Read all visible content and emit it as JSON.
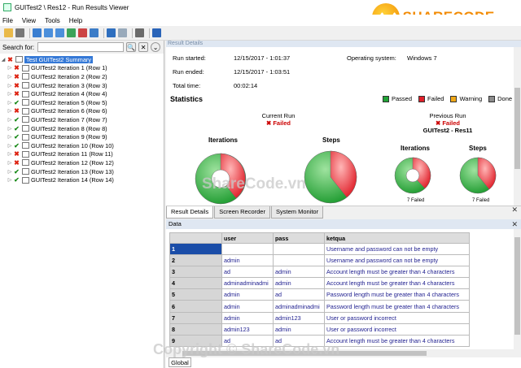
{
  "window": {
    "title": "GUITest2 \\ Res12 - Run Results Viewer"
  },
  "menu": [
    "File",
    "View",
    "Tools",
    "Help"
  ],
  "search": {
    "label": "Search for:"
  },
  "tree": {
    "root": "Test GUITest2 Summary",
    "items": [
      {
        "label": "GUITest2 Iteration 1 (Row 1)",
        "status": "fail"
      },
      {
        "label": "GUITest2 Iteration 2 (Row 2)",
        "status": "fail"
      },
      {
        "label": "GUITest2 Iteration 3 (Row 3)",
        "status": "fail"
      },
      {
        "label": "GUITest2 Iteration 4 (Row 4)",
        "status": "fail"
      },
      {
        "label": "GUITest2 Iteration 5 (Row 5)",
        "status": "pass"
      },
      {
        "label": "GUITest2 Iteration 6 (Row 6)",
        "status": "fail"
      },
      {
        "label": "GUITest2 Iteration 7 (Row 7)",
        "status": "pass"
      },
      {
        "label": "GUITest2 Iteration 8 (Row 8)",
        "status": "pass"
      },
      {
        "label": "GUITest2 Iteration 9 (Row 9)",
        "status": "pass"
      },
      {
        "label": "GUITest2 Iteration 10 (Row 10)",
        "status": "pass"
      },
      {
        "label": "GUITest2 Iteration 11 (Row 11)",
        "status": "fail"
      },
      {
        "label": "GUITest2 Iteration 12 (Row 12)",
        "status": "fail"
      },
      {
        "label": "GUITest2 Iteration 13 (Row 13)",
        "status": "pass"
      },
      {
        "label": "GUITest2 Iteration 14 (Row 14)",
        "status": "pass"
      }
    ]
  },
  "details": {
    "header": "Result Details",
    "run_started_label": "Run started:",
    "run_started": "12/15/2017 - 1:01:37",
    "run_ended_label": "Run ended:",
    "run_ended": "12/15/2017 - 1:03:51",
    "total_time_label": "Total time:",
    "total_time": "00:02:14",
    "os_label": "Operating system:",
    "os": "Windows 7"
  },
  "statistics": {
    "title": "Statistics",
    "legend": [
      {
        "label": "Passed",
        "color": "#21a336"
      },
      {
        "label": "Failed",
        "color": "#e0202a"
      },
      {
        "label": "Warning",
        "color": "#f0a818"
      },
      {
        "label": "Done",
        "color": "#8c8c8c"
      }
    ],
    "current_run": "Current Run",
    "current_status": "✖ Failed",
    "previous_run": "Previous Run",
    "previous_status": "✖ Failed",
    "previous_name": "GUITest2 - Res11",
    "iterations_label": "Iterations",
    "steps_label": "Steps",
    "prev_iter_failed": "7 Failed",
    "prev_steps_failed": "7 Failed"
  },
  "tabs": [
    "Result Details",
    "Screen Recorder",
    "System Monitor"
  ],
  "data_table": {
    "title": "Data",
    "columns": [
      "user",
      "pass",
      "ketqua"
    ],
    "rows": [
      {
        "n": "1",
        "user": "",
        "pass": "",
        "ketqua": "Username and password can not be empty"
      },
      {
        "n": "2",
        "user": "admin",
        "pass": "",
        "ketqua": "Username and password can not be empty"
      },
      {
        "n": "3",
        "user": "ad",
        "pass": "admin",
        "ketqua": "Account length must be greater than 4 characters"
      },
      {
        "n": "4",
        "user": "adminadminadmi",
        "pass": "admin",
        "ketqua": "Account length must be greater than 4 characters"
      },
      {
        "n": "5",
        "user": "admin",
        "pass": "ad",
        "ketqua": "Password length must be greater than 4 characters"
      },
      {
        "n": "6",
        "user": "admin",
        "pass": "adminadminadmi",
        "ketqua": "Password length must be greater than 4 characters"
      },
      {
        "n": "7",
        "user": "admin",
        "pass": "admin123",
        "ketqua": "User or password incorrect"
      },
      {
        "n": "8",
        "user": "admin123",
        "pass": "admin",
        "ketqua": "User or password incorrect"
      },
      {
        "n": "9",
        "user": "ad",
        "pass": "ad",
        "ketqua": "Account length must be greater than 4 characters"
      }
    ],
    "sheet_tab": "Global"
  },
  "watermark": {
    "logo_a": "SHARE",
    "logo_b": "CODE",
    "logo_c": ".vn",
    "center": "ShareCode.vn",
    "bottom": "Copyright © ShareCode.vn"
  }
}
